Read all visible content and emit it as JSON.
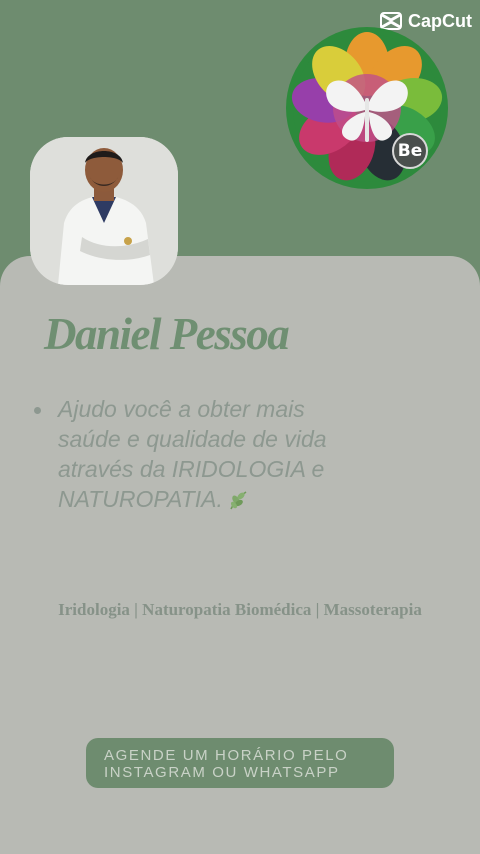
{
  "watermark": {
    "brand": "CapCut",
    "icon": "capcut-logo-icon"
  },
  "profile": {
    "name": "Daniel Pessoa",
    "bio_lines": [
      "Ajudo você a obter mais",
      "saúde e qualidade de vida",
      "através da IRIDOLOGIA e",
      "NATUROPATIA."
    ],
    "bio_emoji": "herb-leaf-icon",
    "services": "Iridologia | Naturopatia Biomédica | Massoterapia",
    "badge": "Be"
  },
  "cta": {
    "line1": "AGENDE UM HORÁRIO PELO",
    "line2": "INSTAGRAM OU WHATSAPP"
  },
  "colors": {
    "background_green": "#6e8c6f",
    "card": "#b8bab4",
    "name_text": "#6f8f72",
    "bio_text": "#8d9890",
    "cta_button": "#6e8c6f"
  }
}
